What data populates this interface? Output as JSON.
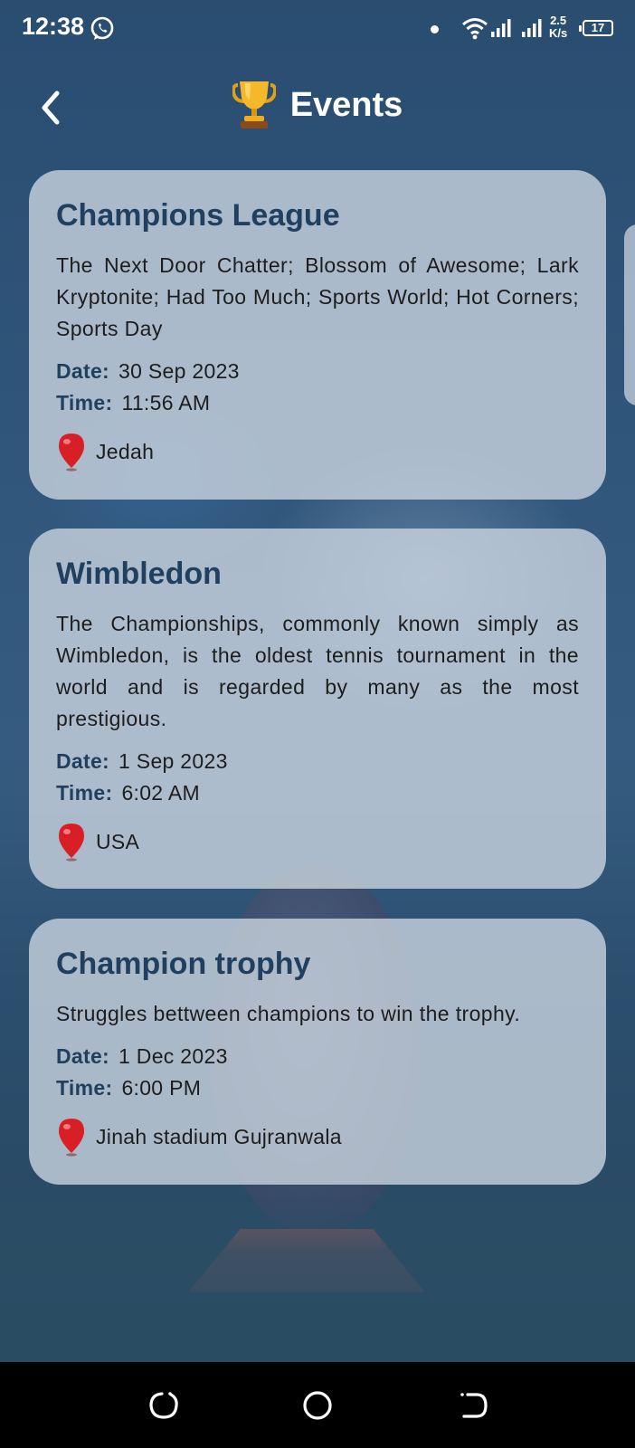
{
  "status_bar": {
    "time": "12:38",
    "speed_value": "2.5",
    "speed_unit": "K/s",
    "battery": "17"
  },
  "header": {
    "title": "Events",
    "icons": [
      "back-arrow-icon",
      "trophy-icon"
    ]
  },
  "events": [
    {
      "title": "Champions League",
      "description": "The Next Door Chatter; Blossom of Awesome; Lark Kryptonite; Had Too Much; Sports World; Hot Corners; Sports Day",
      "date_label": "Date:",
      "date": "30 Sep 2023",
      "time_label": "Time:",
      "time": "11:56 AM",
      "location": "Jedah"
    },
    {
      "title": "Wimbledon",
      "description": "The Championships, commonly known simply as Wimbledon, is the oldest tennis tournament in the world and is regarded by many as the most prestigious.",
      "date_label": "Date:",
      "date": "1 Sep 2023",
      "time_label": "Time:",
      "time": "6:02 AM",
      "location": "USA"
    },
    {
      "title": "Champion trophy",
      "description": "Struggles bettween champions to win the trophy.",
      "date_label": "Date:",
      "date": "1 Dec 2023",
      "time_label": "Time:",
      "time": "6:00 PM",
      "location": "Jinah stadium Gujranwala"
    }
  ],
  "colors": {
    "card_title": "#21405f",
    "card_bg": "#cbd4e0",
    "background": "#274a6b",
    "pin": "#d81f26"
  }
}
